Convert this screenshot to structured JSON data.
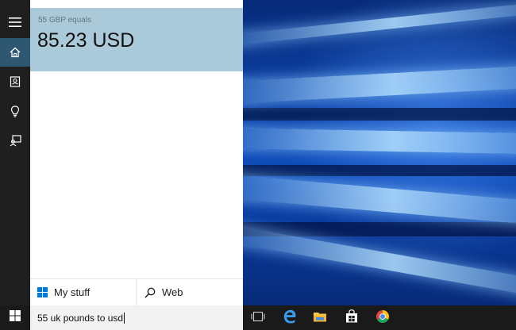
{
  "cortana": {
    "answer": {
      "caption": "55 GBP equals",
      "value": "85.23 USD"
    },
    "rail": {
      "menu_icon": "hamburger-menu-icon",
      "home_icon": "home-icon",
      "notebook_icon": "notebook-icon",
      "interests_icon": "lightbulb-icon",
      "feedback_icon": "feedback-icon"
    },
    "tabs": {
      "mystuff_label": "My stuff",
      "web_label": "Web"
    },
    "search": {
      "query": "55 uk pounds to usd"
    }
  },
  "taskbar": {
    "icons": [
      "task-view-icon",
      "edge-icon",
      "file-explorer-icon",
      "store-icon",
      "chrome-icon"
    ]
  },
  "colors": {
    "answer_card": "#abcad9",
    "rail_bg": "#1f1f1f",
    "rail_active": "#2e5871",
    "taskbar": "#1a1a1a",
    "search_bg": "#f2f2f2",
    "windows_blue": "#0078d7"
  }
}
